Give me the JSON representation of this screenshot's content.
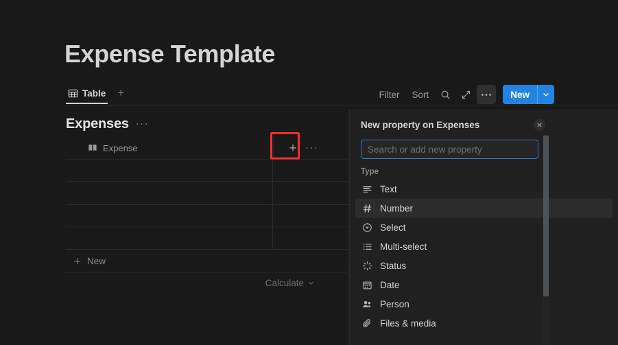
{
  "page": {
    "title": "Expense Template",
    "background_color": "#191919"
  },
  "viewbar": {
    "tabs": [
      {
        "label": "Table",
        "icon": "table-icon",
        "active": true
      }
    ],
    "add_view_label": "+",
    "filter_label": "Filter",
    "sort_label": "Sort",
    "search_icon": "search-icon",
    "expand_icon": "expand-collapse-icon",
    "more_icon": "ellipsis-icon",
    "new_button": {
      "label": "New",
      "color": "#2383e2",
      "chevron_icon": "chevron-down-icon"
    }
  },
  "database": {
    "title": "Expenses",
    "more_label": "···",
    "columns": [
      {
        "label": "Expense",
        "icon": "book-icon"
      }
    ],
    "add_property_label": "+",
    "column_more_label": "···",
    "rows": [
      {
        "expense": ""
      },
      {
        "expense": ""
      },
      {
        "expense": ""
      },
      {
        "expense": ""
      }
    ],
    "new_row_label": "New",
    "new_row_icon": "plus-icon",
    "calculate_label": "Calculate",
    "calculate_icon": "chevron-down-icon"
  },
  "highlight": {
    "color": "#ff2b2b",
    "target": "add-property-button"
  },
  "panel": {
    "title": "New property on Expenses",
    "close_icon": "close-icon",
    "close_label": "×",
    "search": {
      "placeholder": "Search or add new property",
      "value": ""
    },
    "section_label": "Type",
    "types": [
      {
        "label": "Text",
        "icon": "text-lines-icon",
        "hovered": false
      },
      {
        "label": "Number",
        "icon": "hash-icon",
        "hovered": true
      },
      {
        "label": "Select",
        "icon": "select-circle-icon",
        "hovered": false
      },
      {
        "label": "Multi-select",
        "icon": "list-icon",
        "hovered": false
      },
      {
        "label": "Status",
        "icon": "status-spinner-icon",
        "hovered": false
      },
      {
        "label": "Date",
        "icon": "calendar-icon",
        "hovered": false
      },
      {
        "label": "Person",
        "icon": "people-icon",
        "hovered": false
      },
      {
        "label": "Files & media",
        "icon": "paperclip-icon",
        "hovered": false
      }
    ]
  }
}
